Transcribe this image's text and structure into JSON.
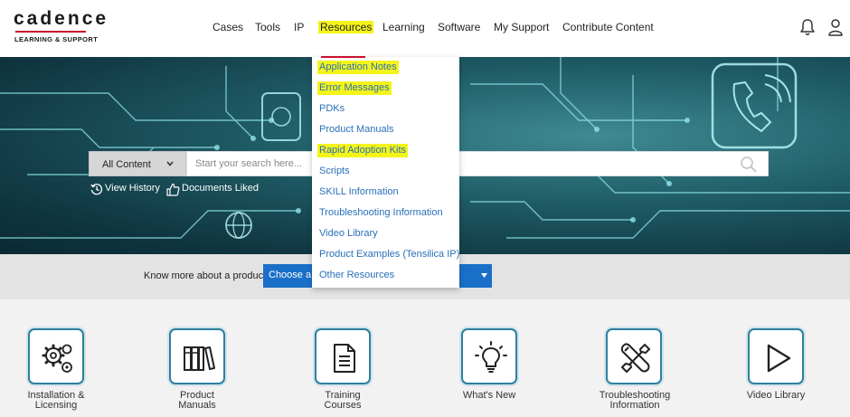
{
  "brand": {
    "name": "cadence",
    "subtitle": "LEARNING & SUPPORT",
    "accent_color": "#c8102e"
  },
  "nav": {
    "items": [
      {
        "label": "Cases"
      },
      {
        "label": "Tools"
      },
      {
        "label": "IP"
      },
      {
        "label": "Resources",
        "active": true
      },
      {
        "label": "Learning"
      },
      {
        "label": "Software"
      },
      {
        "label": "My Support"
      },
      {
        "label": "Contribute Content"
      }
    ],
    "icons": [
      "bell-icon",
      "user-icon"
    ]
  },
  "resources_menu": {
    "items": [
      {
        "label": "Application Notes",
        "highlighted": true
      },
      {
        "label": "Error Messages",
        "highlighted": true
      },
      {
        "label": "PDKs",
        "highlighted": false
      },
      {
        "label": "Product Manuals",
        "highlighted": false
      },
      {
        "label": "Rapid Adoption Kits",
        "highlighted": true
      },
      {
        "label": "Scripts",
        "highlighted": false
      },
      {
        "label": "SKILL Information",
        "highlighted": false
      },
      {
        "label": "Troubleshooting Information",
        "highlighted": false
      },
      {
        "label": "Video Library",
        "highlighted": false
      },
      {
        "label": "Product Examples (Tensilica IP)",
        "highlighted": false
      },
      {
        "label": "Other Resources",
        "highlighted": false
      }
    ],
    "highlight_color": "#f4f41a",
    "link_color": "#2a6fb8"
  },
  "search": {
    "scope": "All Content",
    "placeholder": "Start your search here...",
    "value": ""
  },
  "quick_links": [
    {
      "label": "View History",
      "icon": "history-icon"
    },
    {
      "label": "Documents Liked",
      "icon": "thumbs-up-icon"
    }
  ],
  "product_picker": {
    "label": "Know more about a product:",
    "selected": "Choose a p",
    "color": "#1a70c8"
  },
  "tiles": [
    {
      "label_line1": "Installation &",
      "label_line2": "Licensing",
      "icon": "gears-icon"
    },
    {
      "label_line1": "Product",
      "label_line2": "Manuals",
      "icon": "books-icon"
    },
    {
      "label_line1": "Training",
      "label_line2": "Courses",
      "icon": "document-icon"
    },
    {
      "label_line1": "What's New",
      "label_line2": "",
      "icon": "lightbulb-icon"
    },
    {
      "label_line1": "Troubleshooting",
      "label_line2": "Information",
      "icon": "tools-icon"
    },
    {
      "label_line1": "Video Library",
      "label_line2": "",
      "icon": "play-icon"
    }
  ]
}
